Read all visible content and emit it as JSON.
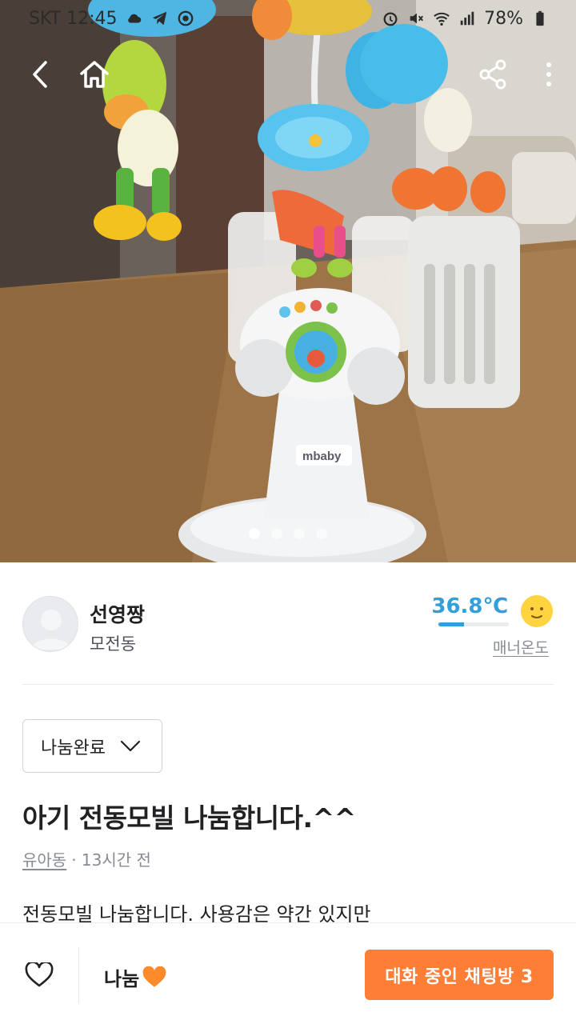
{
  "status_bar": {
    "carrier_time": "SKT 12:45",
    "battery": "78%",
    "icons": [
      "cloud-icon",
      "telegram-icon",
      "record-icon",
      "alarm-icon",
      "mute-icon",
      "wifi-icon",
      "signal-icon",
      "battery-icon"
    ]
  },
  "top_bar": {
    "icons": [
      "back-icon",
      "home-icon",
      "share-icon",
      "more-icon"
    ]
  },
  "gallery": {
    "image_count": 4,
    "active_index": 0,
    "brand_text": "mbaby"
  },
  "seller": {
    "name": "선영짱",
    "location": "모전동",
    "temperature": "36.8℃",
    "temperature_fraction": 0.368,
    "manner_label": "매너온도",
    "temp_color": "#319fd9"
  },
  "post": {
    "status": "나눔완료",
    "title": "아기 전동모빌 나눔합니다.^^",
    "category": "유아동",
    "time": " · 13시간 전",
    "body": "전동모빌 나눔합니다. 사용감은 약간 있지만"
  },
  "bottom_bar": {
    "price": "나눔",
    "chat_button": "대화 중인 채팅방 3",
    "accent": "#ff7e36"
  }
}
